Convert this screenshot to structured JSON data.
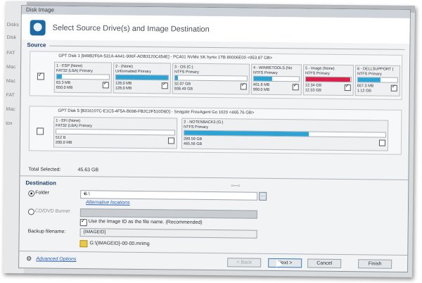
{
  "window": {
    "title": "Disk Image"
  },
  "header": {
    "title": "Select Source Drive(s) and Image Destination"
  },
  "source": {
    "label": "Source",
    "disks": [
      {
        "label": "GPT Disk 1 [949B2F6A-531A-4A41-906F-ADB3120C454E] - PC401 NVMe SK hynix 1TB 80006E00  <953.87 GB>",
        "checked": true,
        "partitions": [
          {
            "name": "1 - ESP (None)",
            "type": "FAT32 (LBA) Primary",
            "used": "63.3 MB",
            "total": "650.0 MB",
            "fill": 0.1,
            "color": "#2aa3d6",
            "checked": true
          },
          {
            "name": "2 - (None)",
            "type": "Unformatted Primary",
            "used": "128.0 MB",
            "total": "128.0 MB",
            "fill": 1.0,
            "color": "#2aa3d6",
            "checked": true
          },
          {
            "name": "3 - OS (C:)",
            "type": "NTFS Primary",
            "used": "32.07 GB",
            "total": "938.49 GB",
            "fill": 0.04,
            "color": "#2aa3d6",
            "checked": true
          },
          {
            "name": "4 - WINRETOOLS (No",
            "type": "NTFS Primary",
            "used": "401.6 MB",
            "total": "990.0 MB",
            "fill": 0.4,
            "color": "#2aa3d6",
            "checked": true
          },
          {
            "name": "5 - Image (None)",
            "type": "NTFS Primary",
            "used": "12.34 GB",
            "total": "12.53 GB",
            "fill": 0.98,
            "color": "#d8204a",
            "checked": true
          },
          {
            "name": "6 - DELLSUPPORT (",
            "type": "NTFS Primary",
            "used": "657.3 MB",
            "total": "1.12 GB",
            "fill": 0.57,
            "color": "#2aa3d6",
            "checked": true
          }
        ]
      },
      {
        "label": "GPT Disk 5 [B316107C-E1C5-4F5A-B098-FB2C2F510D8D] - Seagate  FreeAgent Go    1020  <465.76 GB>",
        "checked": false,
        "partitions": [
          {
            "name": "1 - EFI (None)",
            "type": "FAT32 (LBA) Primary",
            "used": "512 B",
            "total": "200.0 MB",
            "fill": 0.0,
            "color": "#2aa3d6",
            "checked": false
          },
          {
            "name": "2 - NOTENBACK3 (G:)",
            "type": "NTFS Primary",
            "used": "289.59 GB",
            "total": "465.56 GB",
            "fill": 0.62,
            "color": "#2aa3d6",
            "checked": false
          }
        ]
      }
    ],
    "total_selected_label": "Total Selected:",
    "total_selected_value": "45.63 GB"
  },
  "destination": {
    "label": "Destination",
    "folder_label": "Folder",
    "folder_value": "G:\\",
    "alt_locations": "Alternative locations",
    "cd_label": "CD/DVD Burner",
    "use_imageid_label": "Use the Image ID as the file name.  (Recommended)",
    "use_imageid_checked": true,
    "backup_filename_label": "Backup filename:",
    "backup_filename_value": "{IMAGEID}",
    "result_path": "G:\\{IMAGEID}-00-00.mrimg"
  },
  "footer": {
    "advanced": "Advanced Options",
    "back": "< Back",
    "next": "Next >",
    "cancel": "Cancel",
    "finish": "Finish"
  },
  "background_menu": [
    "Disks",
    "Disk",
    "FAT",
    "Mac",
    "Mac",
    "FAT",
    "Mac",
    "tox"
  ]
}
